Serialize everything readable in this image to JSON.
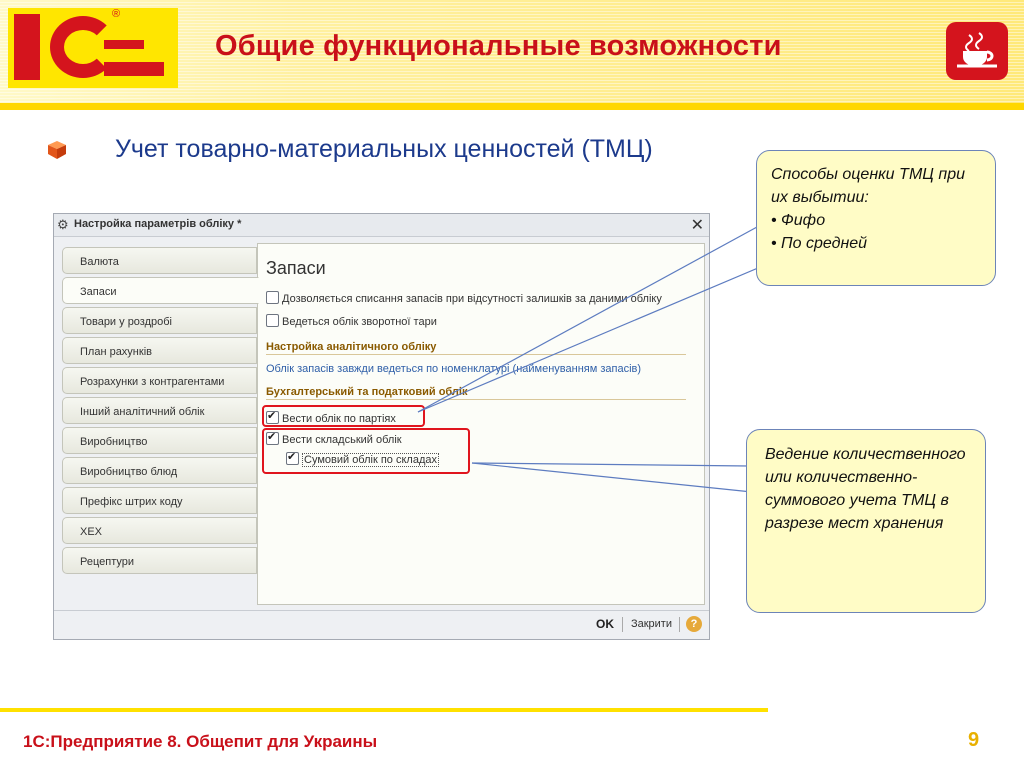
{
  "header": {
    "title": "Общие функциональные возможности",
    "logo_label": "1С",
    "brand_color": "#c9101a"
  },
  "bullet": {
    "text": "Учет товарно-материальных ценностей (ТМЦ)"
  },
  "window": {
    "title": "Настройка параметрів обліку *",
    "tabs": [
      {
        "label": "Валюта"
      },
      {
        "label": "Запаси"
      },
      {
        "label": "Товари у роздробі"
      },
      {
        "label": "План рахунків"
      },
      {
        "label": "Розрахунки з контрагентами"
      },
      {
        "label": "Інший аналітичний облік"
      },
      {
        "label": "Виробництво"
      },
      {
        "label": "Виробництво блюд"
      },
      {
        "label": "Префікс штрих коду"
      },
      {
        "label": "XEX"
      },
      {
        "label": "Рецептури"
      }
    ],
    "active_tab": "Запаси",
    "panel": {
      "title": "Запаси",
      "checkbox_writeoff": {
        "label": "Дозволяється списання запасів при відсутності залишків за даними обліку",
        "checked": false
      },
      "checkbox_tara": {
        "label": "Ведеться облік зворотної тари",
        "checked": false
      },
      "section_analytic": "Настройка аналітичного обліку",
      "info_text": "Облік запасів завжди ведеться по номенклатурі (найменуванням запасів)",
      "section_accounting": "Бухгалтерський та податковий облік",
      "checkbox_parties": {
        "label": "Вести облік по партіях",
        "checked": true
      },
      "checkbox_warehouse": {
        "label": "Вести складський облік",
        "checked": true
      },
      "checkbox_sum": {
        "label": "Сумовий облік по складах",
        "checked": true
      }
    },
    "buttons": {
      "ok": "OK",
      "close": "Закрити",
      "help": "?"
    }
  },
  "callouts": {
    "first": {
      "line1": "Способы оценки ТМЦ при их выбытии:",
      "item1": "• Фифо",
      "item2": "• По средней"
    },
    "second": {
      "text": "Ведение количественного или количественно-суммового учета ТМЦ в разрезе мест хранения"
    }
  },
  "footer": {
    "text": "1С:Предприятие 8. Общепит для Украины",
    "page": "9"
  }
}
